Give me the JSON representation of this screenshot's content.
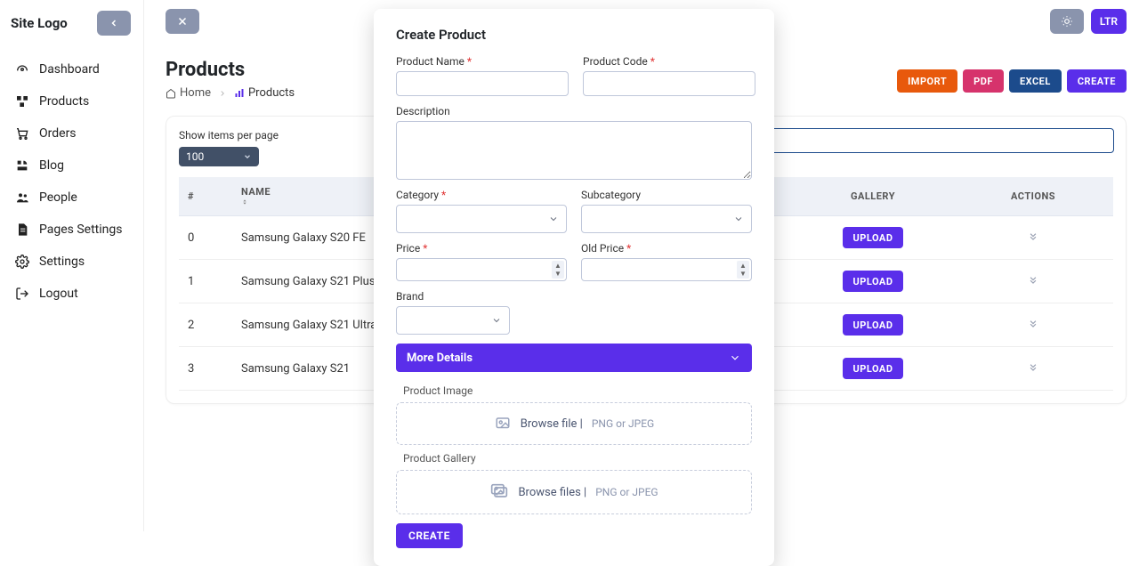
{
  "brand": {
    "logo": "Site Logo"
  },
  "topbar": {
    "ltr": "LTR"
  },
  "sidebar": {
    "items": [
      {
        "label": "Dashboard"
      },
      {
        "label": "Products"
      },
      {
        "label": "Orders"
      },
      {
        "label": "Blog"
      },
      {
        "label": "People"
      },
      {
        "label": "Pages Settings"
      },
      {
        "label": "Settings"
      },
      {
        "label": "Logout"
      }
    ]
  },
  "page": {
    "title": "Products",
    "breadcrumb": {
      "home": "Home",
      "current": "Products"
    }
  },
  "actions": {
    "import": "IMPORT",
    "pdf": "PDF",
    "excel": "EXCEL",
    "create": "CREATE"
  },
  "list": {
    "show_label": "Show items per page",
    "ipp": "100",
    "columns": {
      "index": "#",
      "name": "NAME",
      "gallery": "GALLERY",
      "actions": "ACTIONS"
    },
    "upload_label": "UPLOAD",
    "rows": [
      {
        "index": "0",
        "name": "Samsung Galaxy S20 FE"
      },
      {
        "index": "1",
        "name": "Samsung Galaxy S21 Plus"
      },
      {
        "index": "2",
        "name": "Samsung Galaxy S21 Ultra"
      },
      {
        "index": "3",
        "name": "Samsung Galaxy S21"
      }
    ]
  },
  "modal": {
    "title": "Create Product",
    "labels": {
      "product_name": "Product Name",
      "product_code": "Product Code",
      "description": "Description",
      "category": "Category",
      "subcategory": "Subcategory",
      "price": "Price",
      "old_price": "Old Price",
      "brand": "Brand",
      "more_details": "More Details",
      "product_image": "Product Image",
      "product_gallery": "Product Gallery"
    },
    "upload": {
      "browse_file": "Browse file |",
      "browse_files": "Browse files |",
      "hint": "PNG or JPEG"
    },
    "submit": "CREATE"
  }
}
